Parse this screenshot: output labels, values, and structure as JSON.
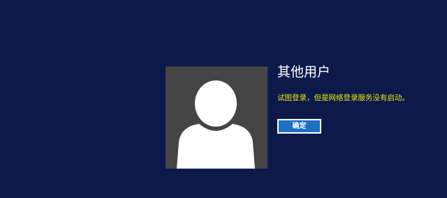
{
  "login": {
    "username": "其他用户",
    "message": "试图登录，但是网络登录服务没有启动。",
    "ok_button_label": "确定",
    "avatar_icon": "user-silhouette-icon"
  },
  "colors": {
    "background": "#0c1a4b",
    "avatar_background": "#454545",
    "message_text": "#e8e40f",
    "button_background": "#1f6fc4",
    "button_border": "#ffffff"
  }
}
